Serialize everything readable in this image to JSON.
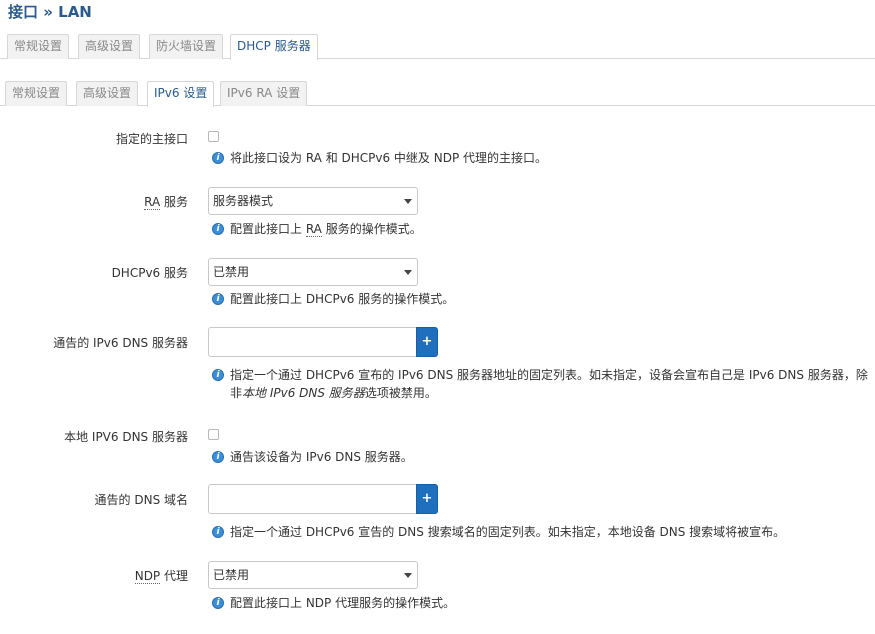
{
  "page": {
    "title": "接口 » LAN"
  },
  "top_tabs": [
    {
      "label": "常规设置"
    },
    {
      "label": "高级设置"
    },
    {
      "label": "防火墙设置"
    },
    {
      "label": "DHCP 服务器"
    }
  ],
  "sub_tabs": [
    {
      "label": "常规设置"
    },
    {
      "label": "高级设置"
    },
    {
      "label": "IPv6 设置"
    },
    {
      "label": "IPv6 RA 设置"
    }
  ],
  "fields": {
    "master": {
      "label": "指定的主接口",
      "help": "将此接口设为 RA 和 DHCPv6 中继及 NDP 代理的主接口。"
    },
    "ra": {
      "label_abbr": "RA",
      "label_rest": " 服务",
      "value": "服务器模式",
      "help_pre": "配置此接口上 ",
      "help_abbr": "RA",
      "help_post": " 服务的操作模式。"
    },
    "dhcpv6": {
      "label": "DHCPv6 服务",
      "value": "已禁用",
      "help": "配置此接口上 DHCPv6 服务的操作模式。"
    },
    "ipv6_dns": {
      "label": "通告的 IPv6 DNS 服务器",
      "value": "",
      "add_label": "+",
      "help_pre": "指定一个通过 DHCPv6 宣布的 IPv6 DNS 服务器地址的固定列表。如未指定，设备会宣布自己是 IPv6 DNS 服务器，除非",
      "help_em": "本地 IPv6 DNS 服务器",
      "help_post": "选项被禁用。"
    },
    "local_dns": {
      "label": "本地 IPV6 DNS 服务器",
      "help": "通告该设备为 IPv6 DNS 服务器。"
    },
    "dns_domain": {
      "label": "通告的 DNS 域名",
      "value": "",
      "add_label": "+",
      "help": "指定一个通过 DHCPv6 宣告的 DNS 搜索域名的固定列表。如未指定，本地设备 DNS 搜索域将被宣布。"
    },
    "ndp": {
      "label_abbr": "NDP",
      "label_rest": " 代理",
      "value": "已禁用",
      "help": "配置此接口上 NDP 代理服务的操作模式。"
    }
  },
  "icons": {
    "help": "info-icon",
    "select": "chevron-down-icon"
  },
  "colors": {
    "title": "#2a5b8c",
    "accent": "#1f6fbf",
    "info": "#3a8fd8"
  }
}
